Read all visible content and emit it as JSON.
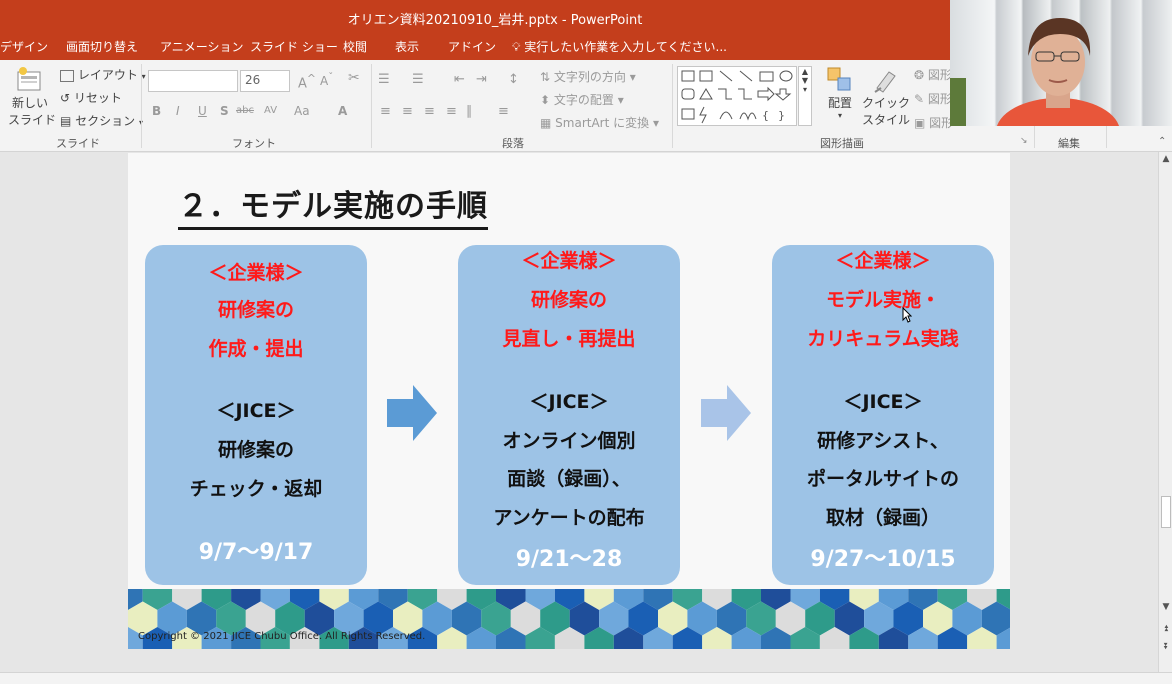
{
  "window": {
    "title": "オリエン資料20210910_岩井.pptx - PowerPoint"
  },
  "tabs": [
    "デザイン",
    "画面切り替え",
    "アニメーション",
    "スライド ショー",
    "校閲",
    "表示",
    "アドイン"
  ],
  "tell_me": "実行したい作業を入力してください...",
  "ribbon": {
    "slides": {
      "new_slide": "新しい",
      "new_slide_2": "スライド",
      "layout": "レイアウト",
      "reset": "リセット",
      "section": "セクション",
      "label": "スライド"
    },
    "font": {
      "size": "26",
      "bold": "B",
      "italic": "I",
      "underline": "U",
      "strike": "S",
      "shadow": "abc",
      "spacing": "AV",
      "case": "Aa",
      "label": "フォント"
    },
    "paragraph": {
      "text_direction": "文字列の方向",
      "align_text": "文字の配置",
      "smartart": "SmartArt に変換",
      "label": "段落"
    },
    "drawing": {
      "arrange": "配置",
      "quick_style_1": "クイック",
      "quick_style_2": "スタイル",
      "shape_1": "図形",
      "shape_2": "図形",
      "shape_3": "図形",
      "label": "図形描画"
    },
    "editing": {
      "label": "編集"
    }
  },
  "slide": {
    "title": "２．モデル実施の手順",
    "cards": [
      {
        "red": [
          "＜企業様＞",
          "研修案の",
          "作成・提出"
        ],
        "black": [
          "＜JICE＞",
          "研修案の",
          "チェック・返却"
        ],
        "date": "9/7～9/17"
      },
      {
        "red": [
          "＜企業様＞",
          "研修案の",
          "見直し・再提出"
        ],
        "black": [
          "＜JICE＞",
          "オンライン個別",
          "面談（録画）、",
          "アンケートの配布"
        ],
        "date": "9/21～28"
      },
      {
        "red": [
          "＜企業様＞",
          "モデル実施・",
          "カリキュラム実践"
        ],
        "black": [
          "＜JICE＞",
          "研修アシスト、",
          "ポータルサイトの",
          "取材（録画）"
        ],
        "date": "9/27～10/15"
      }
    ],
    "copyright": "Copyright © 2021 JICE Chubu Office. All Rights Reserved.",
    "colors": {
      "card": "#9dc3e6",
      "arrow_1": "#5b9bd5",
      "arrow_2": "#a9c4e8",
      "red_text": "#ff1a1a",
      "ribbon_accent": "#c43e1c"
    }
  }
}
